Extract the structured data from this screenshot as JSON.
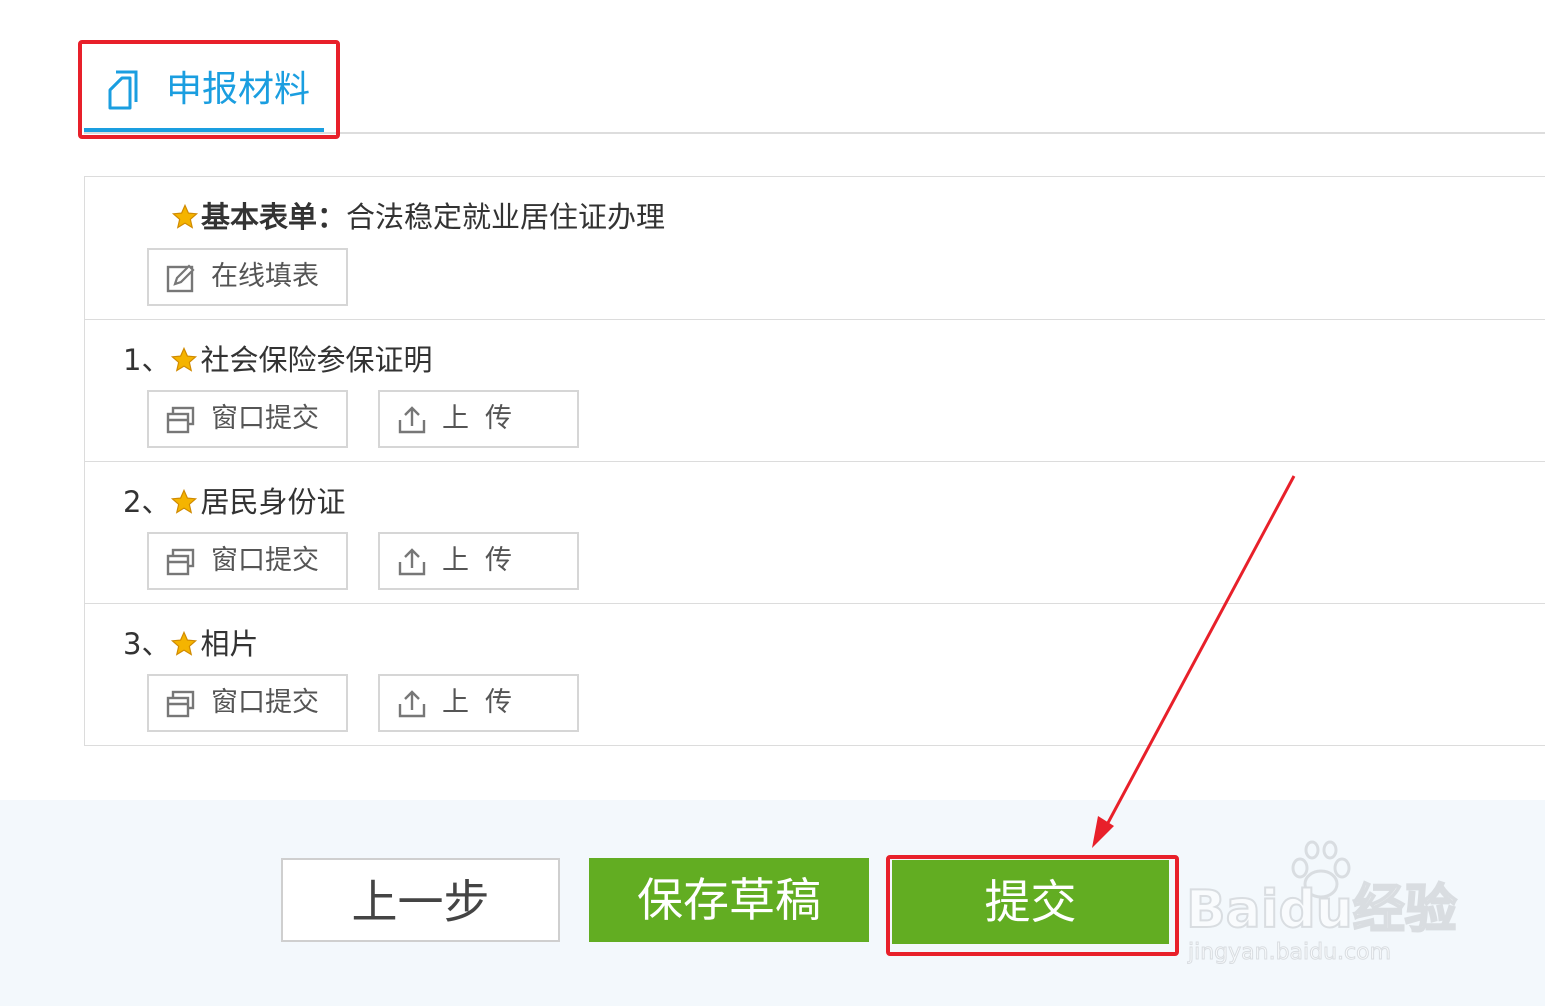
{
  "tab": {
    "label": "申报材料",
    "icon": "document-copy-icon"
  },
  "colors": {
    "accent": "#1a9ee0",
    "primary_button": "#62ad22",
    "annotation": "#e8202a",
    "star": "#f5b400"
  },
  "basic_form": {
    "label_prefix": "基本表单：",
    "name": "合法稳定就业居住证办理",
    "fill_button": "在线填表",
    "fill_icon": "edit-icon"
  },
  "materials": [
    {
      "index": "1、",
      "name": "社会保险参保证明",
      "window_button": "窗口提交",
      "upload_button": "上传"
    },
    {
      "index": "2、",
      "name": "居民身份证",
      "window_button": "窗口提交",
      "upload_button": "上传"
    },
    {
      "index": "3、",
      "name": "相片",
      "window_button": "窗口提交",
      "upload_button": "上传"
    }
  ],
  "footer": {
    "prev": "上一步",
    "save_draft": "保存草稿",
    "submit": "提交"
  },
  "watermark": {
    "brand": "Baidu经验",
    "url": "jingyan.baidu.com"
  }
}
